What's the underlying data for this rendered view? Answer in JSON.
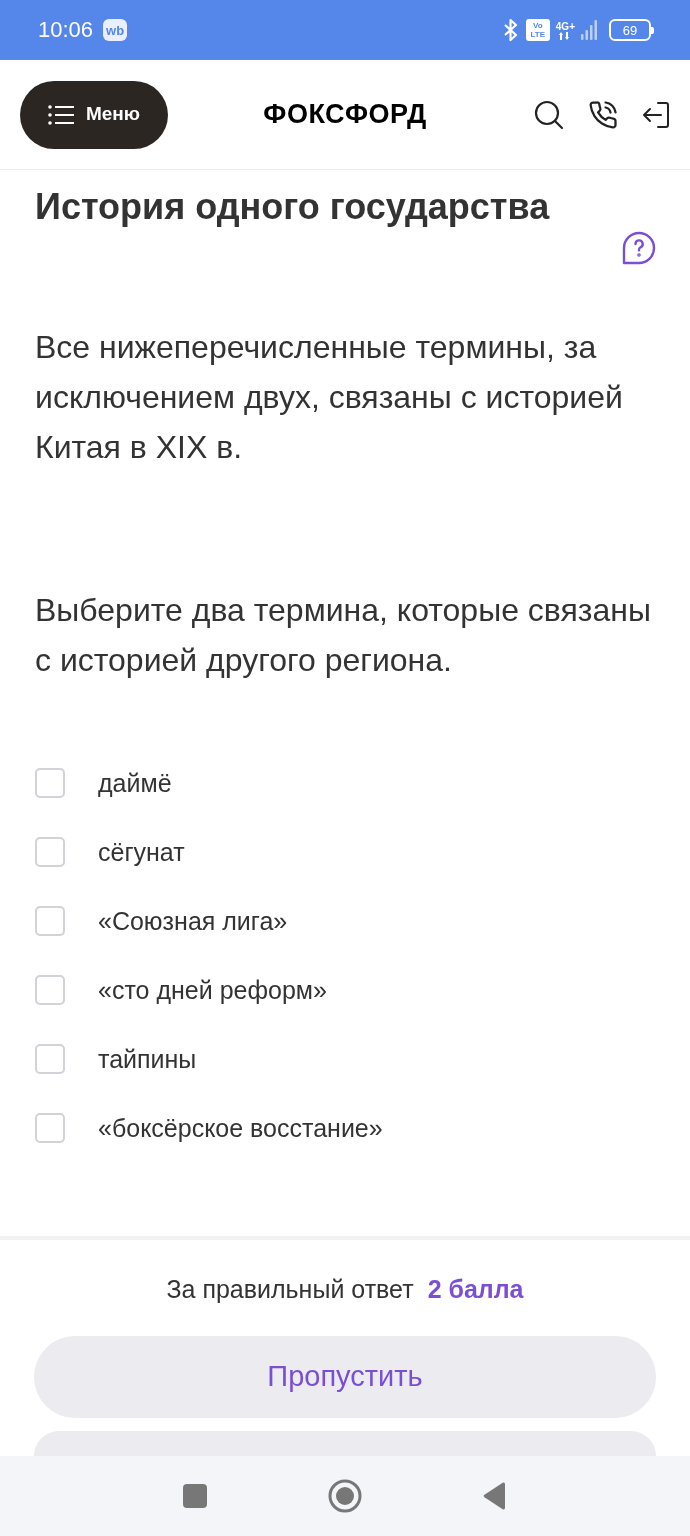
{
  "status_bar": {
    "time": "10:06",
    "app_badge": "wb",
    "volte": "Vo LTE",
    "network": "4G+",
    "battery": "69"
  },
  "header": {
    "menu_button": "Меню",
    "logo": "ФОКСФОРД"
  },
  "task": {
    "title": "История одного государства",
    "paragraphs": [
      "Все нижеперечисленные термины, за исключением двух, связаны с историей Китая в XIX в.",
      "Выберите два термина, которые связаны с историей другого региона."
    ],
    "options": [
      {
        "label": "даймё",
        "checked": false
      },
      {
        "label": "сёгунат",
        "checked": false
      },
      {
        "label": "«Союзная лига»",
        "checked": false
      },
      {
        "label": "«сто дней реформ»",
        "checked": false
      },
      {
        "label": "тайпины",
        "checked": false
      },
      {
        "label": "«боксёрское восстание»",
        "checked": false
      }
    ]
  },
  "footer": {
    "score_label": "За правильный ответ",
    "score_value": "2 балла",
    "skip_button": "Пропустить"
  }
}
